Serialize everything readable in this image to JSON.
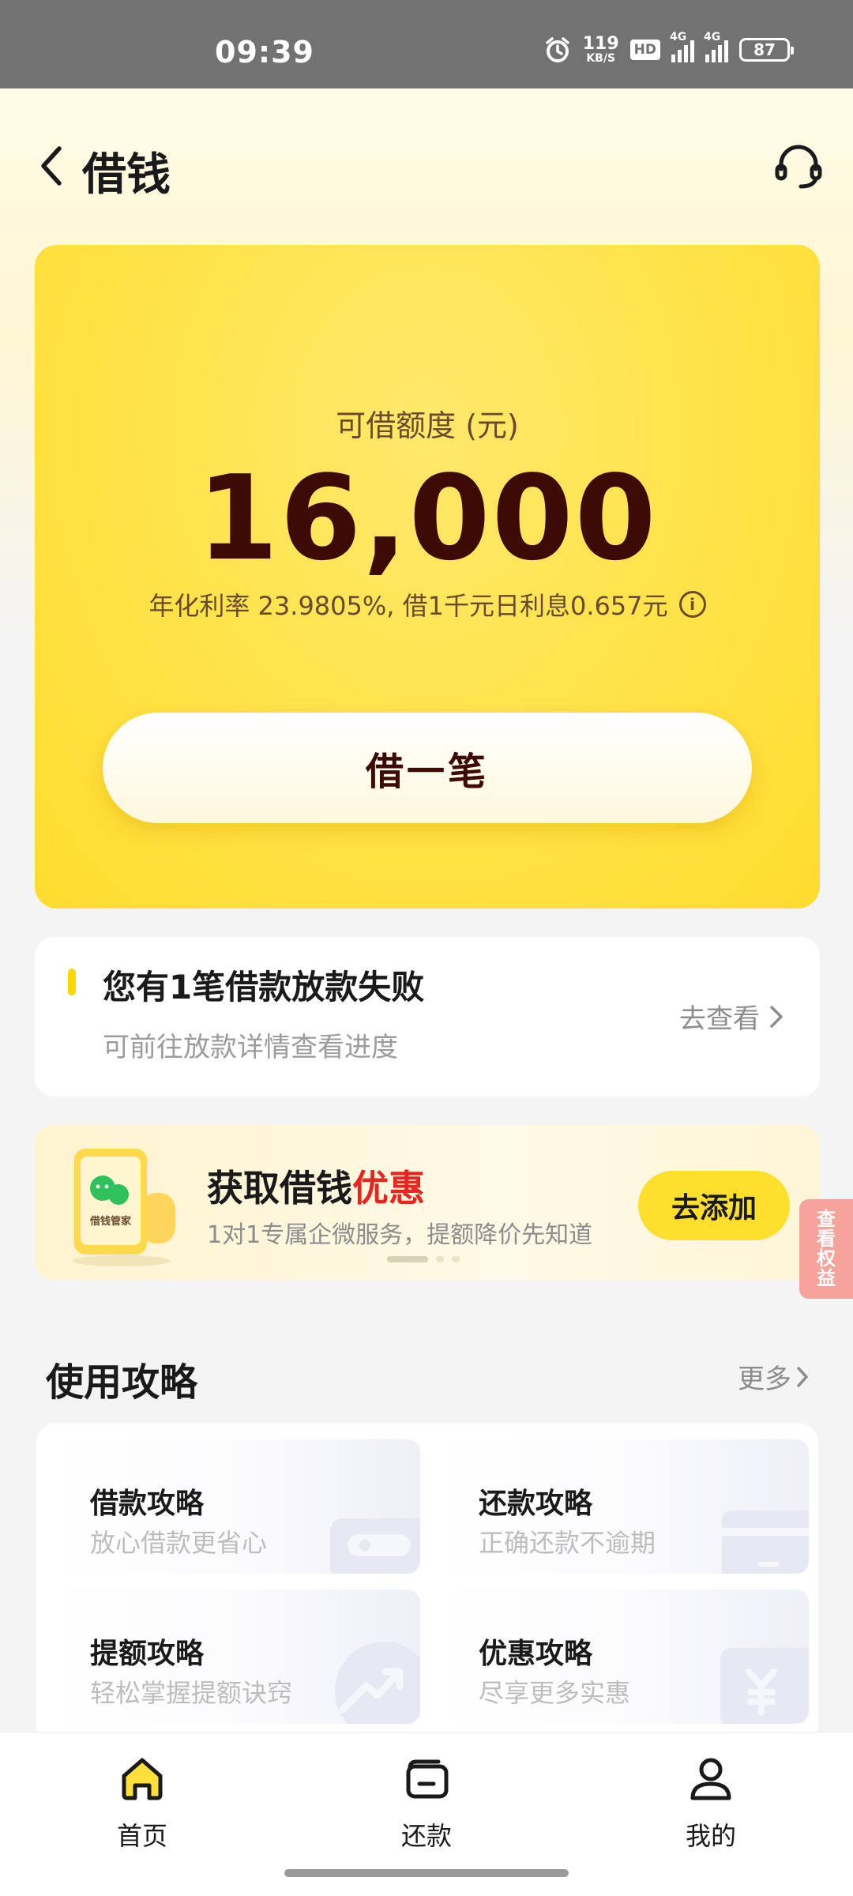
{
  "status_bar": {
    "time": "09:39",
    "net_speed_value": "119",
    "net_speed_unit": "KB/S",
    "hd_label": "HD",
    "signal1_label": "4G",
    "signal2_label": "4G",
    "battery": "87"
  },
  "header": {
    "title": "借钱",
    "back_icon": "chevron-left-icon",
    "service_icon": "headset-icon"
  },
  "credit": {
    "label": "可借额度 (元)",
    "amount": "16,000",
    "rate_text": "年化利率 23.9805%, 借1千元日利息0.657元",
    "info_icon": "i",
    "borrow_button": "借一笔"
  },
  "notice": {
    "title": "您有1笔借款放款失败",
    "subtitle": "可前往放款详情查看进度",
    "link": "去查看"
  },
  "promo": {
    "title_main": "获取借钱",
    "title_highlight": "优惠",
    "subtitle": "1对1专属企微服务，提额降价先知道",
    "button": "去添加",
    "illustration_text": "借钱管家"
  },
  "side_tag": [
    "查",
    "看",
    "权",
    "益"
  ],
  "guide": {
    "title": "使用攻略",
    "more": "更多",
    "items": [
      {
        "title": "借款攻略",
        "subtitle": "放心借款更省心"
      },
      {
        "title": "还款攻略",
        "subtitle": "正确还款不逾期"
      },
      {
        "title": "提额攻略",
        "subtitle": "轻松掌握提额诀窍"
      },
      {
        "title": "优惠攻略",
        "subtitle": "尽享更多实惠"
      }
    ]
  },
  "bottom_nav": {
    "tabs": [
      {
        "label": "首页",
        "icon": "home-icon"
      },
      {
        "label": "还款",
        "icon": "wallet-icon"
      },
      {
        "label": "我的",
        "icon": "profile-icon"
      }
    ]
  },
  "colors": {
    "accent_yellow": "#ffdf2e",
    "amount_color": "#3e0a06",
    "highlight_red": "#e8261f"
  }
}
